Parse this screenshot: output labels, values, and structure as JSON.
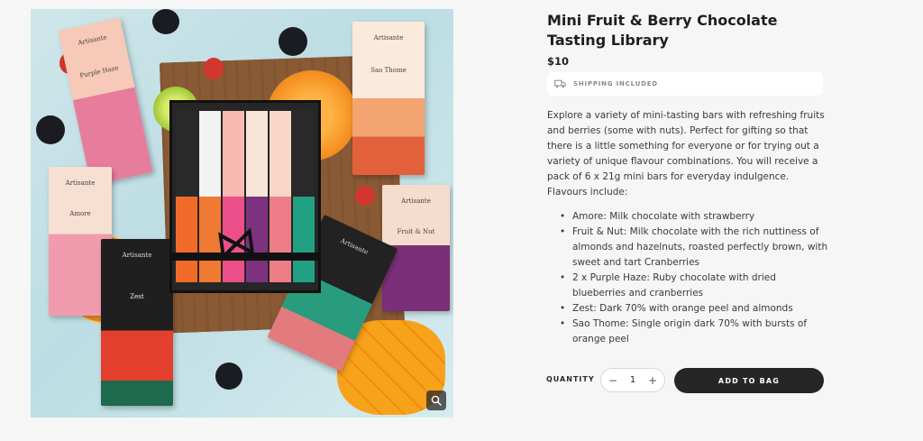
{
  "product": {
    "title": "Mini Fruit & Berry Chocolate Tasting Library",
    "price": "$10",
    "shipping_label": "SHIPPING INCLUDED",
    "description": "Explore a variety of mini-tasting bars with refreshing fruits and berries (some with nuts). Perfect for gifting so that there is a little something for everyone or for trying out a variety of unique flavour combinations. You will receive a pack of 6 x 21g mini bars for everyday indulgence. Flavours include:",
    "flavours": [
      "Amore: Milk chocolate with strawberry",
      "Fruit & Nut: Milk chocolate with the rich nuttiness of almonds and hazelnuts, roasted perfectly brown, with sweet and tart Cranberries",
      "2 x Purple Haze: Ruby chocolate with dried blueberries and cranberries",
      "Zest: Dark 70% with orange peel and almonds",
      "Sao Thome: Single origin dark 70% with bursts of orange peel"
    ]
  },
  "purchase": {
    "quantity_label": "QUANTITY",
    "quantity_value": "1",
    "minus": "−",
    "plus": "+",
    "add_to_bag_label": "ADD TO BAG"
  },
  "image_labels": {
    "brand": "Artisante",
    "purple_haze": "Purple Haze",
    "sao_thome": "Sao Thome",
    "amore": "Amore",
    "fruit_nut": "Fruit & Nut",
    "zest": "Zest"
  },
  "icons": {
    "shipping": "truck-icon",
    "zoom": "zoom-icon"
  },
  "colors": {
    "accent": "#262626",
    "background": "#f6f6f6"
  }
}
